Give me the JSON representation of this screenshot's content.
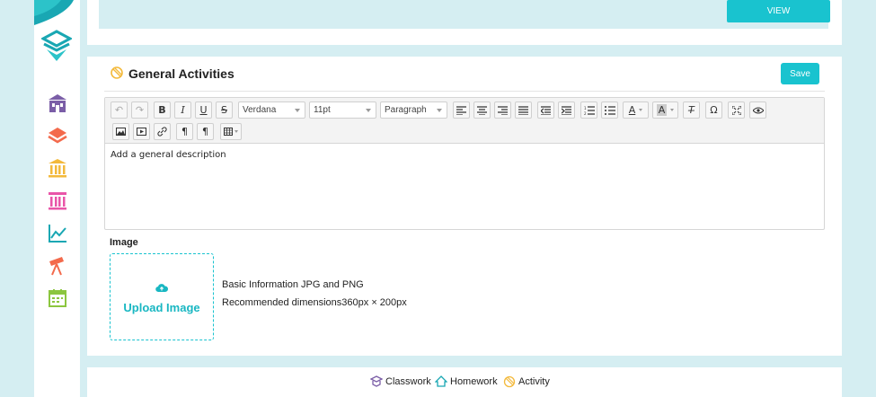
{
  "top": {
    "view_label": "VIEW"
  },
  "card": {
    "title": "General Activities",
    "save_label": "Save"
  },
  "editor": {
    "font_family": "Verdana",
    "font_size": "11pt",
    "block_format": "Paragraph",
    "body_text": "Add a general description"
  },
  "image": {
    "label": "Image",
    "upload_label": "Upload Image",
    "info_formats": "Basic Information JPG and PNG",
    "info_dimensions": "Recommended dimensions360px × 200px"
  },
  "tabs": [
    {
      "label": "Classwork",
      "icon": "classwork-icon"
    },
    {
      "label": "Homework",
      "icon": "homework-icon"
    },
    {
      "label": "Activity",
      "icon": "activity-icon"
    }
  ],
  "sidebar": {
    "items": [
      {
        "icon": "school-building-icon",
        "color": "#7b5ea7"
      },
      {
        "icon": "layers-icon",
        "color": "#f36a4c"
      },
      {
        "icon": "bank-icon",
        "color": "#f3b93b"
      },
      {
        "icon": "institution-icon",
        "color": "#e955a8"
      },
      {
        "icon": "chart-line-icon",
        "color": "#19a7b3"
      },
      {
        "icon": "telescope-icon",
        "color": "#f36a4c"
      },
      {
        "icon": "calendar-icon",
        "color": "#8cc63f"
      }
    ]
  },
  "colors": {
    "accent": "#19c3cf",
    "background": "#d5eef2"
  }
}
